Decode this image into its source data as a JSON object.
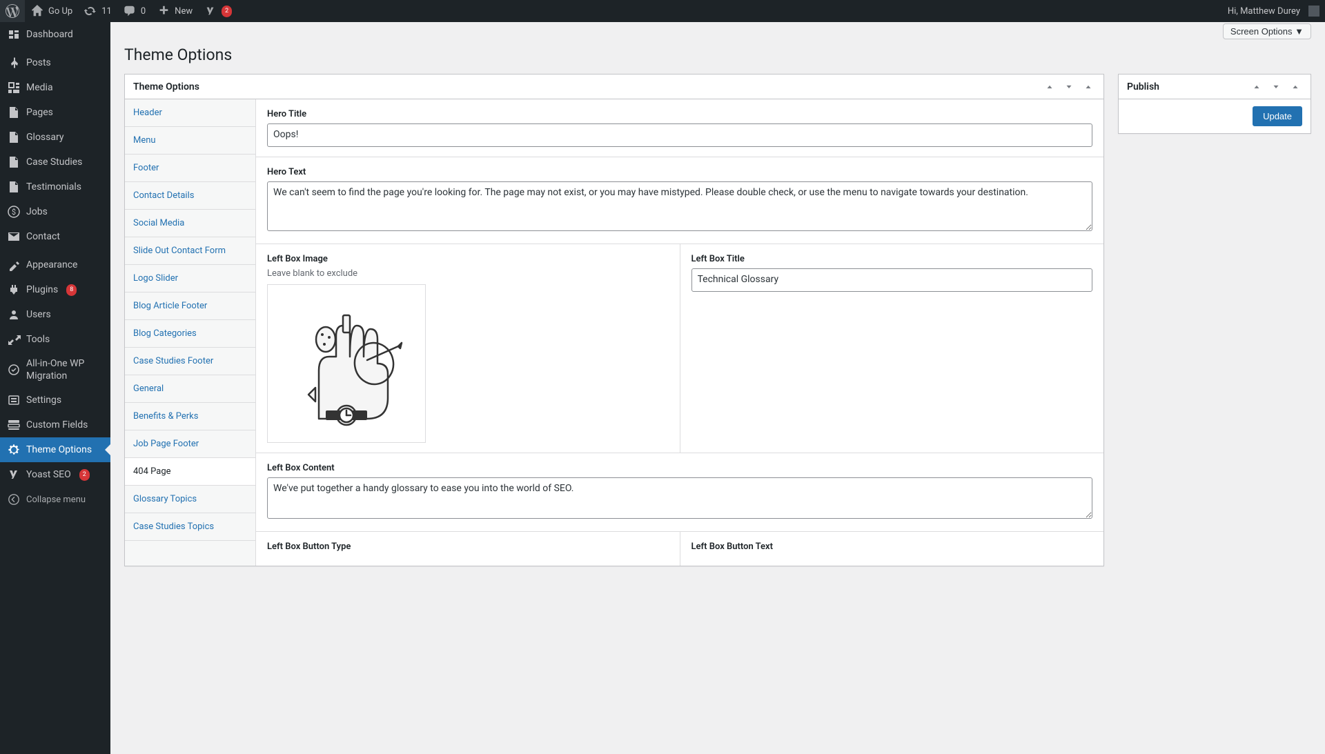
{
  "admin_bar": {
    "site_name": "Go Up",
    "updates": "11",
    "comments": "0",
    "new": "New",
    "yoast_badge": "2",
    "greeting": "Hi, Matthew Durey"
  },
  "sidebar": [
    {
      "label": "Dashboard",
      "icon": "dashboard"
    },
    {
      "label": "Posts",
      "icon": "pin"
    },
    {
      "label": "Media",
      "icon": "media"
    },
    {
      "label": "Pages",
      "icon": "page"
    },
    {
      "label": "Glossary",
      "icon": "page"
    },
    {
      "label": "Case Studies",
      "icon": "page"
    },
    {
      "label": "Testimonials",
      "icon": "page"
    },
    {
      "label": "Jobs",
      "icon": "money"
    },
    {
      "label": "Contact",
      "icon": "mail"
    },
    {
      "label": "Appearance",
      "icon": "appearance"
    },
    {
      "label": "Plugins",
      "icon": "plugin",
      "badge": "8"
    },
    {
      "label": "Users",
      "icon": "users"
    },
    {
      "label": "Tools",
      "icon": "tools"
    },
    {
      "label": "All-in-One WP Migration",
      "icon": "migration"
    },
    {
      "label": "Settings",
      "icon": "settings"
    },
    {
      "label": "Custom Fields",
      "icon": "custom-fields"
    },
    {
      "label": "Theme Options",
      "icon": "gear",
      "current": true
    },
    {
      "label": "Yoast SEO",
      "icon": "yoast",
      "badge": "2"
    }
  ],
  "collapse_label": "Collapse menu",
  "screen_options": "Screen Options",
  "page_title": "Theme Options",
  "theme_options_box_title": "Theme Options",
  "tabs": [
    "Header",
    "Menu",
    "Footer",
    "Contact Details",
    "Social Media",
    "Slide Out Contact Form",
    "Logo Slider",
    "Blog Article Footer",
    "Blog Categories",
    "Case Studies Footer",
    "General",
    "Benefits & Perks",
    "Job Page Footer",
    "404 Page",
    "Glossary Topics",
    "Case Studies Topics"
  ],
  "active_tab": "404 Page",
  "fields": {
    "hero_title_label": "Hero Title",
    "hero_title_value": "Oops!",
    "hero_text_label": "Hero Text",
    "hero_text_value": "We can't seem to find the page you're looking for. The page may not exist, or you may have mistyped. Please double check, or use the menu to navigate towards your destination.",
    "left_box_image_label": "Left Box Image",
    "left_box_image_desc": "Leave blank to exclude",
    "left_box_title_label": "Left Box Title",
    "left_box_title_value": "Technical Glossary",
    "left_box_content_label": "Left Box Content",
    "left_box_content_value": "We've put together a handy glossary to ease you into the world of SEO.",
    "left_box_button_type_label": "Left Box Button Type",
    "left_box_button_text_label": "Left Box Button Text"
  },
  "publish": {
    "title": "Publish",
    "update": "Update"
  }
}
